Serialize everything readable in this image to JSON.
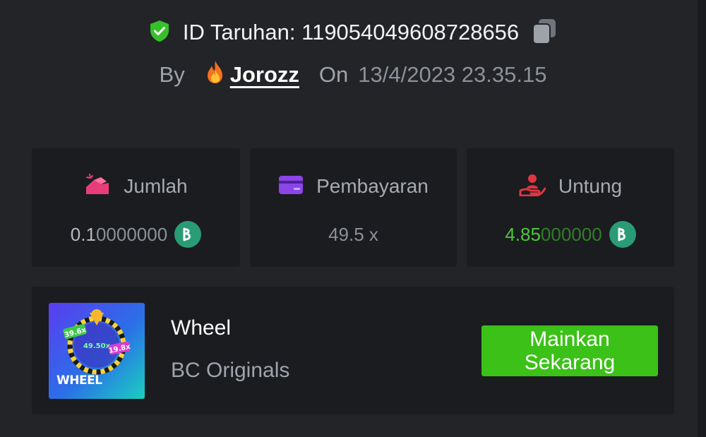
{
  "bet": {
    "id_text": "ID Taruhan: 119054049608728656",
    "by_label": "By",
    "username": "Jorozz",
    "on_label": "On",
    "date": "13/4/2023 23.35.15"
  },
  "stats": {
    "amount": {
      "label": "Jumlah",
      "value_bright": "0.1",
      "value_dim": "0000000",
      "currency_icon": "bc-coin-icon"
    },
    "payout": {
      "label": "Pembayaran",
      "value": "49.5 x"
    },
    "profit": {
      "label": "Untung",
      "value_bright": "4.85",
      "value_dim": "000000",
      "currency_icon": "bc-coin-icon"
    }
  },
  "game": {
    "thumbnail": {
      "title": "WHEEL",
      "badge_left": "39.6x",
      "badge_center": "49.50x",
      "badge_right": "19.8x"
    },
    "name": "Wheel",
    "provider": "BC Originals",
    "play_button": "Mainkan\nSekarang"
  },
  "colors": {
    "background": "#232427",
    "card": "#1b1c1f",
    "accent_green": "#3bc117",
    "profit_green": "#4cc73a",
    "coin": "#2a9c75",
    "amount_icon": "#e93d7a",
    "payout_icon": "#8b45e8",
    "profit_icon": "#e0363f",
    "shield": "#36c12a"
  }
}
